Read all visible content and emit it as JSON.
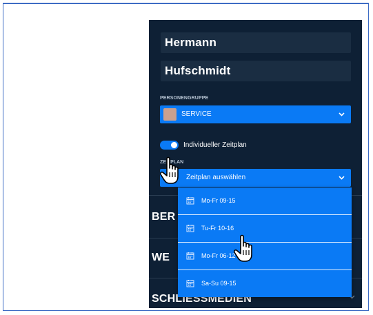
{
  "person": {
    "first_name": "Hermann",
    "last_name": "Hufschmidt"
  },
  "personengruppe": {
    "label": "PERSONENGRUPPE",
    "selected": "SERVICE",
    "swatch_color": "#c9a08e"
  },
  "individual_schedule": {
    "label": "Individueller Zeitplan",
    "enabled": true
  },
  "zeitplan": {
    "label": "ZEITPLAN",
    "placeholder": "Zeitplan auswählen",
    "options": [
      "Mo-Fr 09-15",
      "Tu-Fr 10-16",
      "Mo-Fr 06-12",
      "Sa-Su 09-15"
    ]
  },
  "sections": {
    "first": "BER",
    "second": "WE",
    "third": "SCHLIESSMEDIEN"
  },
  "colors": {
    "panel_bg": "#0e2035",
    "accent": "#0a7af5",
    "frame_border": "#3e6cc4"
  },
  "icons": {
    "chevron": "chevron-down-icon",
    "calendar": "calendar-icon",
    "cursor": "hand-pointer-icon"
  }
}
